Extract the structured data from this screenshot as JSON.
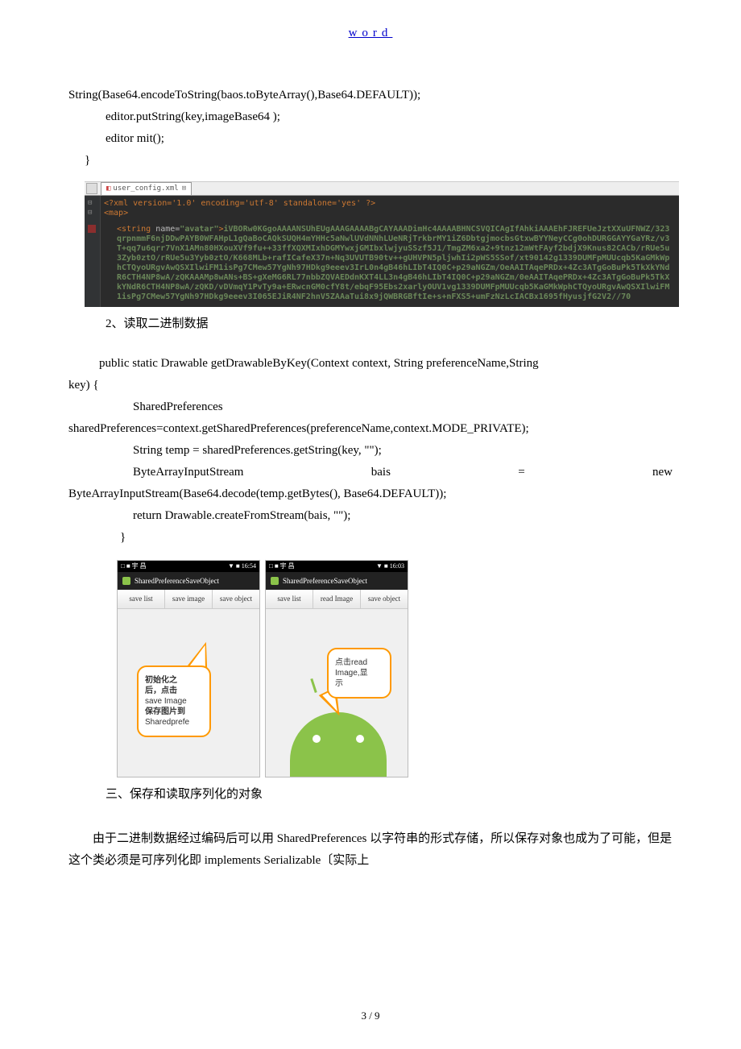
{
  "header": {
    "link_text": "word"
  },
  "code_top": {
    "l1": "String(Base64.encodeToString(baos.toByteArray(),Base64.DEFAULT));",
    "l2": "editor.putString(key,imageBase64 );",
    "l3": "editor       mit();",
    "l4": "}"
  },
  "xml": {
    "tab_filename": "user_config.xml",
    "decl": "<?xml version='1.0' encoding='utf-8' standalone='yes' ?>",
    "map_open": "<map>",
    "string_open": "<string",
    "attr_name": "name=",
    "attr_val": "\"avatar\"",
    "close": ">",
    "encoded": "iVBORw0KGgoAAAANSUhEUgAAAGAAAABgCAYAAADimHc4AAAABHNCSVQICAgIfAhkiAAAEhFJREFUeJztXXuUFNWZ/323qrpnmmF6njDDwPAYB0WFAHpL1gQaBoCAQkSUQH4mYHHc5aNwlUVdNNhLUeNRjTrkbrMY1iZ6DbtgjmocbsGtxwBYYNeyCCg0ohDURGGAYYGaYRz/v3T+qq7u6qrr7VnX1AMn80HXouXVf9fu++33ffXQXMIxhDGMYwxjGMIbxlwjyuSSzf5J1/TmgZM6xa2+9tnz12mWtFAyf2bdjX9Knus82CACb/rRUe5u3Zyb0ztO/rRUe5u3Yyb0ztO/K668MLb+rafICafeX37n+Nq3UVUTB90tv++gUHVPN5pljwhIi2pWS5SSof/xt90142g1339DUMFpMUUcqb5KaGMkWphCTQyoURgvAwQSXIlwiFM1isPg7CMew57YgNh97HDkg9eeev3IrL0n4gB46hLIbT4IQ0C+p29aNGZm/OeAAITAqePRDx+4Zc3ATgGoBuPk5TkXkYNdR6CTH4NP8wA/zQKAAAMp8wANs+BS+gXeMG6RL77nbbZQVAEDdnKXT4LL3n4gB46hLIbT4IQ0C+p29aNGZm/0eAAITAqePRDx+4Zc3ATgGoBuPk5TkXkYNdR6CTH4NP8wA/zQKD/vDVmqY1PvTy9a+ERwcnGM0cfY8t/ebqF95Ebs2xarlyOUV1vg1339DUMFpMUUcqb5KaGMkWphCTQyoURgvAwQSXIlwiFM1isPg7CMew57YgNh97HDkg9eeev3I065EJiR4NF2hnV5ZAAaTui8x9jQWBRGBftIe+s+nFXS5+umFzNzLcIACBx1695fHyusjfG2V2//70"
  },
  "heading_read_binary": "2、读取二进制数据",
  "code_mid": {
    "l1_a": "public static Drawable getDrawableByKey(Context context, String preferenceName,String",
    "l1_b": "key) {",
    "l2": "SharedPreferences",
    "l3": "sharedPreferences=context.getSharedPreferences(preferenceName,context.MODE_PRIVATE);",
    "l4": "String temp = sharedPreferences.getString(key, \"\");",
    "l5_a": "ByteArrayInputStream",
    "l5_b": "bais",
    "l5_c": "=",
    "l5_d": "new",
    "l6": "ByteArrayInputStream(Base64.decode(temp.getBytes(), Base64.DEFAULT));",
    "l7": "return Drawable.createFromStream(bais, \"\");",
    "l8": "}"
  },
  "phone1": {
    "status_left": "□ ■ 宇 昌",
    "status_right": "▼ ■ 16:54",
    "app_title": "SharedPreferenceSaveObject",
    "btn1": "save list",
    "btn2": "save image",
    "btn3": "save object",
    "bubble_l1": "初始化之",
    "bubble_l2": "后，点击",
    "bubble_l3": "save Image",
    "bubble_l4": "保存图片到",
    "bubble_l5": "Sharedprefe"
  },
  "phone2": {
    "status_left": "□ ■ 宇 昌",
    "status_right": "▼ ■ 16:03",
    "app_title": "SharedPreferenceSaveObject",
    "btn1": "save list",
    "btn2": "read Image",
    "btn3": "save object",
    "bubble_l1": "点击read",
    "bubble_l2": "Image,显",
    "bubble_l3": "示"
  },
  "heading_serialize": "三、保存和读取序列化的对象",
  "final_para": "由于二进制数据经过编码后可以用 SharedPreferences 以字符串的形式存储，所以保存对象也成为了可能，但是这个类必须是可序列化即 implements         Serializable〔实际上",
  "page_num": "3 / 9"
}
